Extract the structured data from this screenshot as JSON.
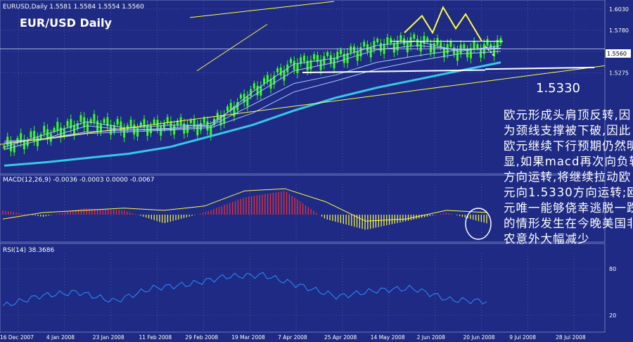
{
  "colors": {
    "background": "#1e2a83",
    "grid": "#6f7bb8",
    "axis_text": "#ffffff",
    "candle": "#36ff22",
    "ma_bright": "#35c9e8",
    "ma_thin": "#a9c7ff",
    "trendline": "#ffff40",
    "hist_pos": "#ff3030",
    "hist_neg": "#ffff40",
    "signal": "#ffff40",
    "rsi_line": "#2f8cff",
    "annotation_text": "#ffffff",
    "price_box_bg": "#ffffff",
    "price_box_text": "#000000"
  },
  "chart_data": [
    {
      "type": "line",
      "panel": "price",
      "info": "EURUSD,Daily  1.5581 1.5584 1.5554 1.5560",
      "title": "EUR/USD Daily",
      "x": [
        "16 Dec 2007",
        "4 Jan 2008",
        "23 Jan 2008",
        "11 Feb 2008",
        "29 Feb 2008",
        "19 Mar 2008",
        "7 Apr 2008",
        "25 Apr 2008",
        "14 May 2008",
        "2 Jun 2008",
        "20 Jun 2008",
        "9 Jul 2008",
        "28 Jul 2008"
      ],
      "ylim": [
        1.41,
        1.612
      ],
      "yticks": [
        "1.6030",
        "1.5780",
        "1.5530",
        "1.5275"
      ],
      "current_price": "1.5560",
      "series": [
        {
          "values": [
            1.44,
            1.455,
            1.47,
            1.462,
            1.466,
            1.465,
            1.505,
            1.538,
            1.545,
            1.56,
            1.565,
            1.553,
            1.56
          ]
        },
        {
          "values": [
            1.437,
            1.45,
            1.465,
            1.46,
            1.462,
            1.468,
            1.5,
            1.53,
            1.54,
            1.555,
            1.56,
            1.555,
            1.557
          ]
        },
        {
          "values": [
            1.445,
            1.45,
            1.458,
            1.46,
            1.461,
            1.465,
            1.49,
            1.515,
            1.525,
            1.54,
            1.548,
            1.555,
            1.556
          ]
        },
        {
          "values": [
            1.447,
            1.449,
            1.456,
            1.458,
            1.46,
            1.463,
            1.48,
            1.505,
            1.518,
            1.532,
            1.542,
            1.55,
            1.553
          ]
        },
        {
          "values": [
            1.418,
            1.422,
            1.427,
            1.432,
            1.44,
            1.453,
            1.466,
            1.483,
            1.498,
            1.51,
            1.52,
            1.53,
            1.54
          ]
        }
      ],
      "annotation_level": "1.5330",
      "annotation_text": "欧元形成头肩顶反转,因为颈线支撑被下破,因此欧元继续下行预期仍然明显,如果macd再次向负轴方向运转,将继续拉动欧元向1.5330方向运转;欧元唯一能够侥幸逃脱一跌的情形发生在今晚美国非农意外大幅减少"
    },
    {
      "type": "bar",
      "panel": "macd",
      "info": "MACD(12,26,9) -0.0036 -0.0003 0.0000 -0.0067",
      "ylim": [
        -0.012,
        0.014
      ],
      "values_note": "",
      "histogram": [
        0.002,
        -0.001,
        0.003,
        0.002,
        -0.004,
        0.001,
        0.008,
        0.011,
        -0.002,
        -0.007,
        -0.003,
        0.001,
        -0.004
      ],
      "signal": [
        -0.002,
        0.001,
        0.002,
        0.003,
        0.002,
        0.004,
        0.011,
        0.012,
        0.006,
        -0.003,
        -0.002,
        0.002,
        0.001
      ]
    },
    {
      "type": "line",
      "panel": "rsi",
      "info": "RSI(14) 38.3686",
      "ylim": [
        0,
        100
      ],
      "yticks": [
        "80",
        "20"
      ],
      "values": [
        32,
        45,
        50,
        38,
        55,
        60,
        70,
        72,
        58,
        44,
        52,
        55,
        40,
        38
      ]
    }
  ]
}
